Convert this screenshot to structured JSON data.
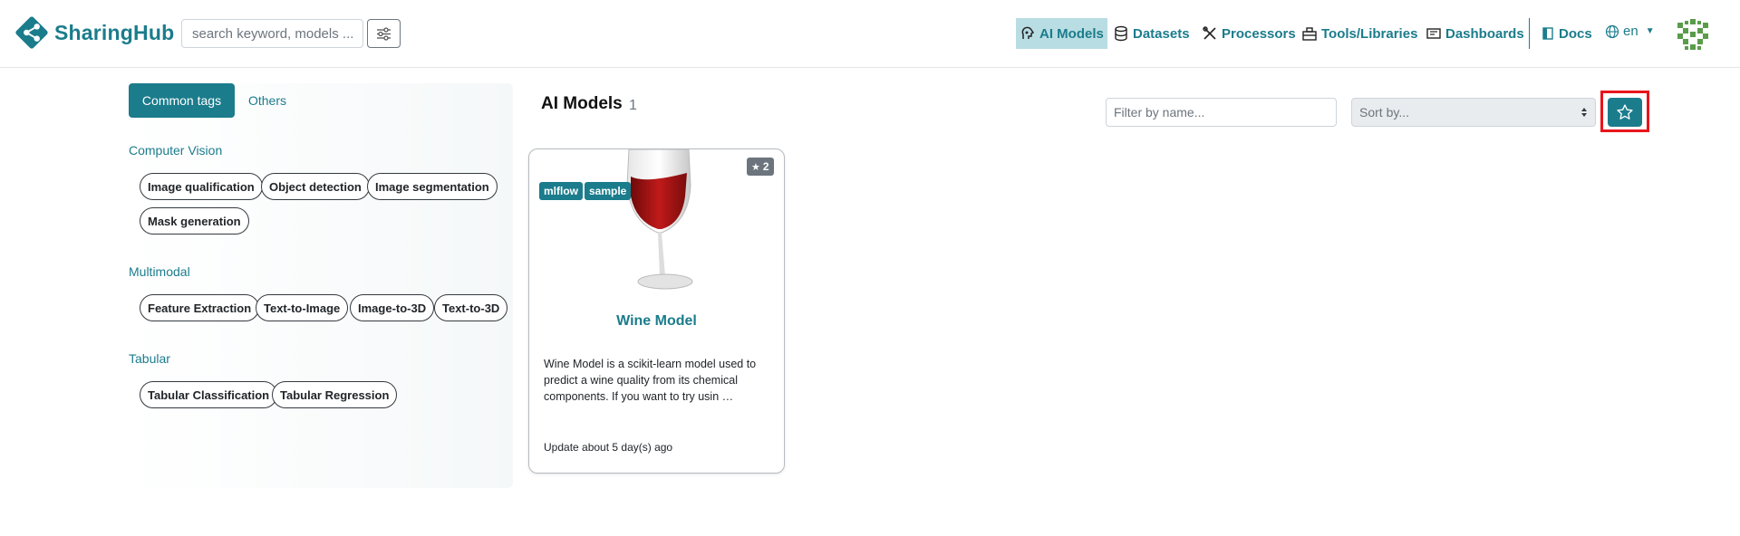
{
  "brand": {
    "name": "SharingHub"
  },
  "search": {
    "placeholder": "search keyword, models ..."
  },
  "nav": {
    "items": [
      {
        "label": "AI Models",
        "icon": "brain-icon"
      },
      {
        "label": "Datasets",
        "icon": "database-icon"
      },
      {
        "label": "Processors",
        "icon": "tools-icon"
      },
      {
        "label": "Tools/Libraries",
        "icon": "toolbox-icon"
      },
      {
        "label": "Dashboards",
        "icon": "dashboard-icon"
      }
    ],
    "docs": "Docs",
    "lang": "en"
  },
  "sidebar": {
    "tabs": [
      "Common tags",
      "Others"
    ],
    "sections": [
      {
        "title": "Computer Vision",
        "tags": [
          "Image qualification",
          "Object detection",
          "Image segmentation",
          "Mask generation"
        ]
      },
      {
        "title": "Multimodal",
        "tags": [
          "Feature Extraction",
          "Text-to-Image",
          "Image-to-3D",
          "Text-to-3D"
        ]
      },
      {
        "title": "Tabular",
        "tags": [
          "Tabular Classification",
          "Tabular Regression"
        ]
      }
    ]
  },
  "main": {
    "title": "AI Models",
    "count": "1",
    "filter_placeholder": "Filter by name...",
    "sort_placeholder": "Sort by..."
  },
  "card": {
    "badges": [
      "mlflow",
      "sample"
    ],
    "stars": "2",
    "title": "Wine Model",
    "description": "Wine Model is a scikit-learn model used to predict a wine quality from its chemical components. If you want to try usin …",
    "updated": "Update about 5 day(s) ago"
  },
  "colors": {
    "accent": "#1b7c8c",
    "highlight": "#e8151b"
  }
}
